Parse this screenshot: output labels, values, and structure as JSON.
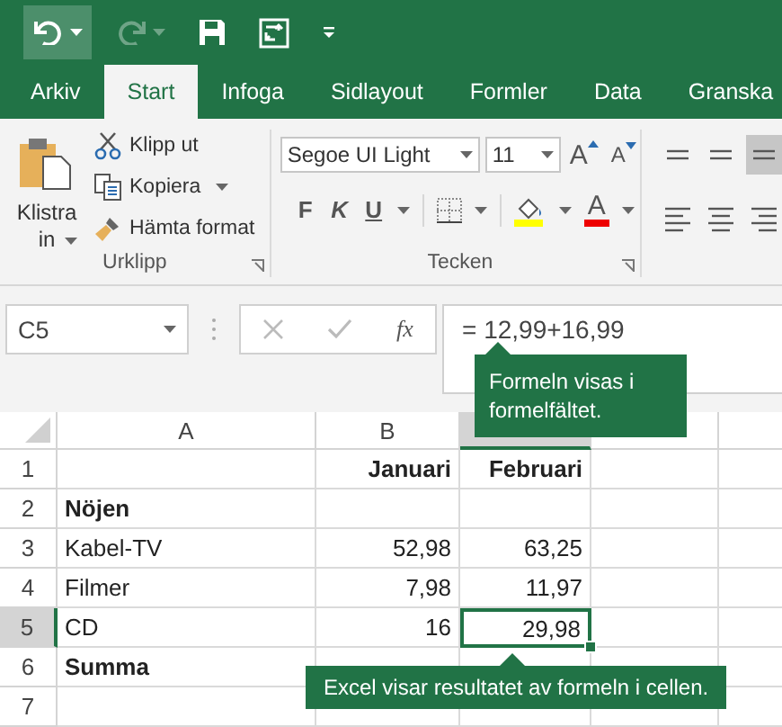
{
  "quick_access": [
    {
      "kind": "undo",
      "highlighted": true,
      "disabled": false
    },
    {
      "kind": "redo",
      "highlighted": false,
      "disabled": true
    },
    {
      "kind": "save",
      "highlighted": false,
      "disabled": false
    },
    {
      "kind": "touch",
      "highlighted": false,
      "disabled": false
    },
    {
      "kind": "customize",
      "highlighted": false,
      "disabled": false
    }
  ],
  "tabs": [
    {
      "label": "Arkiv",
      "selected": false
    },
    {
      "label": "Start",
      "selected": true
    },
    {
      "label": "Infoga",
      "selected": false
    },
    {
      "label": "Sidlayout",
      "selected": false
    },
    {
      "label": "Formler",
      "selected": false
    },
    {
      "label": "Data",
      "selected": false
    },
    {
      "label": "Granska",
      "selected": false
    }
  ],
  "clipboard": {
    "paste_label": "Klistra in",
    "commands": [
      {
        "kind": "cut",
        "label": "Klipp ut"
      },
      {
        "kind": "copy",
        "label": "Kopiera"
      },
      {
        "kind": "format_painter",
        "label": "Hämta format"
      }
    ],
    "label": "Urklipp"
  },
  "font": {
    "name": "Segoe UI Light",
    "size": "11",
    "grow": "A",
    "shrink": "A",
    "styles": [
      {
        "kind": "bold",
        "label": "F"
      },
      {
        "kind": "italic",
        "label": "K"
      },
      {
        "kind": "underline",
        "label": "U"
      }
    ],
    "font_color": "A",
    "label": "Tecken"
  },
  "alignment": [
    {
      "kind": "top",
      "selected": false
    },
    {
      "kind": "middle",
      "selected": false
    },
    {
      "kind": "bottom",
      "selected": true
    },
    {
      "kind": "left",
      "selected": false
    },
    {
      "kind": "center",
      "selected": false
    },
    {
      "kind": "right",
      "selected": false
    }
  ],
  "formula_bar": {
    "name_box": "C5",
    "fx": "fx",
    "formula": "= 12,99+16,99"
  },
  "sheet": {
    "columns": [
      {
        "label": "A",
        "selected": false
      },
      {
        "label": "B",
        "selected": false
      },
      {
        "selected": true
      }
    ],
    "rows": [
      {
        "number": "1",
        "selected": false,
        "bold": true,
        "b": "Januari",
        "c": "Februari"
      },
      {
        "number": "2",
        "selected": false,
        "bold": true,
        "a": "Nöjen"
      },
      {
        "number": "3",
        "selected": false,
        "bold": false,
        "a": "Kabel-TV",
        "b": "52,98",
        "c": "63,25"
      },
      {
        "number": "4",
        "selected": false,
        "bold": false,
        "a": "Filmer",
        "b": "7,98",
        "c": "11,97"
      },
      {
        "number": "5",
        "selected": true,
        "bold": false,
        "a": "CD",
        "b": "16",
        "c": "29,98"
      },
      {
        "number": "6",
        "selected": false,
        "bold": true,
        "a": "Summa"
      },
      {
        "number": "7",
        "selected": false
      }
    ]
  },
  "callouts": [
    {
      "text": "Formeln visas i formelfältet."
    },
    {
      "text": "Excel visar resultatet av formeln i cellen."
    }
  ]
}
